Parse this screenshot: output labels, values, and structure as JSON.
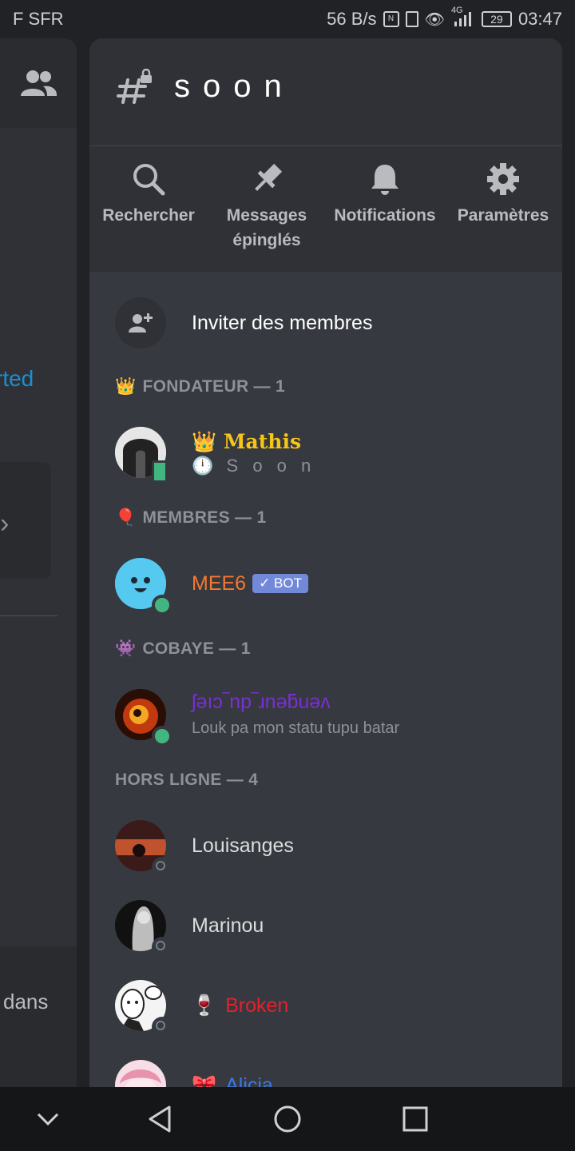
{
  "status_bar": {
    "carrier": "F SFR",
    "speed": "56 B/s",
    "nfc": "N",
    "network": "4G",
    "battery": "29",
    "time": "03:47"
  },
  "left_panel": {
    "partial_link": "rted",
    "partial_text": "dans"
  },
  "channel": {
    "name": "soon"
  },
  "actions": [
    {
      "label": "Rechercher",
      "icon": "search-icon"
    },
    {
      "label": "Messages épinglés",
      "icon": "pin-icon"
    },
    {
      "label": "Notifications",
      "icon": "bell-icon"
    },
    {
      "label": "Paramètres",
      "icon": "gear-icon"
    }
  ],
  "invite": {
    "label": "Inviter des membres"
  },
  "sections": {
    "founder": {
      "emoji": "👑",
      "title": "FONDATEUR — 1"
    },
    "members": {
      "emoji": "🎈",
      "title": "MEMBRES — 1"
    },
    "cobaye": {
      "emoji": "👾",
      "title": "COBAYE — 1"
    },
    "offline": {
      "title": "HORS LIGNE — 4"
    }
  },
  "members": {
    "mathis": {
      "prefix": "👑",
      "name": "Mathis",
      "status_emoji": "🕛",
      "status_text": "S o o n",
      "name_color": "#f5c518"
    },
    "mee6": {
      "name": "MEE6",
      "badge": "✓ BOT",
      "name_color": "#f57731"
    },
    "vengeur": {
      "name": "ʃǝıɔ‾np‾ɹnǝƃuǝʌ",
      "status_text": "Louk pa mon statu tupu batar",
      "name_color": "#7a2fd2"
    },
    "louisanges": {
      "name": "Louisanges"
    },
    "marinou": {
      "name": "Marinou"
    },
    "broken": {
      "prefix": "🍷",
      "name": "Broken",
      "name_color": "#e5202c"
    },
    "alicia": {
      "prefix": "🎀",
      "name": "Alicia",
      "name_color": "#3b78e7"
    }
  }
}
